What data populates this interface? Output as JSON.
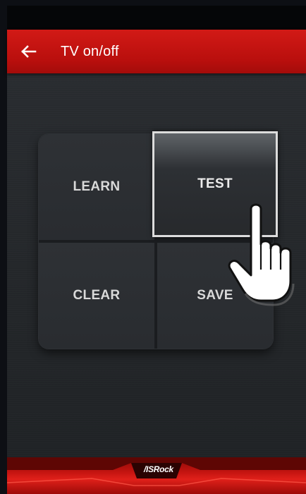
{
  "app_bar": {
    "title": "TV on/off",
    "back_icon": "arrow-left-icon",
    "color": "#c8130f"
  },
  "pad": {
    "keys": {
      "learn": "LEARN",
      "test": "TEST",
      "clear": "CLEAR",
      "save": "SAVE"
    },
    "pressed_key": "test"
  },
  "footer": {
    "brand": "/ISRock",
    "color": "#c41410"
  },
  "cursor_icon": "hand-pointer-icon"
}
